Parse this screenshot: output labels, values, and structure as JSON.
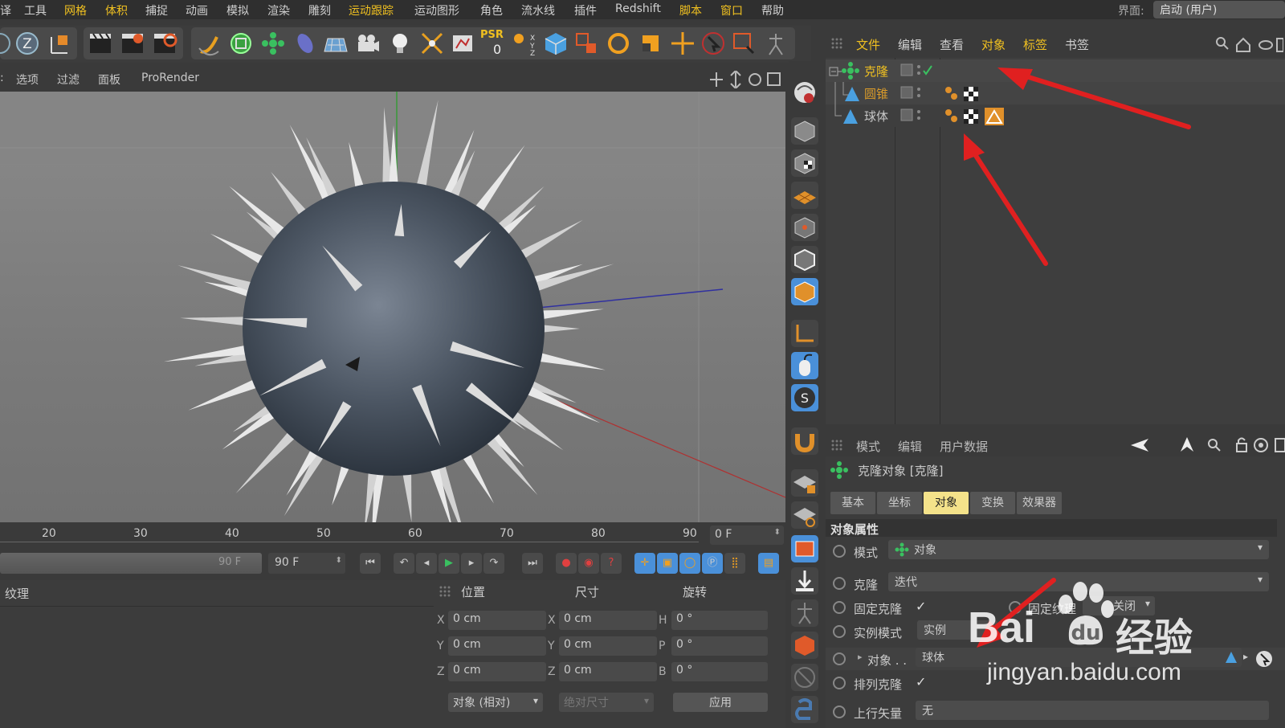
{
  "menubar": {
    "items": [
      "译",
      "工具",
      "网格",
      "体积",
      "捕捉",
      "动画",
      "模拟",
      "渲染",
      "雕刻",
      "运动跟踪",
      "运动图形",
      "角色",
      "流水线",
      "插件",
      "Redshift",
      "脚本",
      "窗口",
      "帮助"
    ],
    "interface_label": "界面:",
    "interface_value": "启动 (用户)"
  },
  "toolbar": {
    "psr_label": "PSR",
    "psr_value": "0"
  },
  "viewport": {
    "menu": [
      "选项",
      "过滤",
      "面板",
      "ProRender"
    ]
  },
  "object_manager": {
    "menu": [
      "文件",
      "编辑",
      "查看",
      "对象",
      "标签",
      "书签"
    ],
    "objects": [
      {
        "name": "克隆",
        "color": "#f0c020"
      },
      {
        "name": "圆锥",
        "color": "#d89a2a"
      },
      {
        "name": "球体",
        "color": "#c8c8c8"
      }
    ]
  },
  "attribute_manager": {
    "menu": [
      "模式",
      "编辑",
      "用户数据"
    ],
    "title": "克隆对象 [克隆]",
    "tabs": [
      "基本",
      "坐标",
      "对象",
      "变换",
      "效果器"
    ],
    "active_tab": "对象",
    "section": "对象属性",
    "props": {
      "mode_label": "模式",
      "mode_value": "对象",
      "clone_label": "克隆",
      "clone_value": "迭代",
      "fixed_clone_label": "固定克隆",
      "fixed_tex_label": "固定纹理",
      "fixed_tex_value": "关闭",
      "instance_label": "实例模式",
      "instance_value": "实例",
      "object_label": "对象 . .",
      "object_value": "球体",
      "arrange_label": "排列克隆",
      "up_vector_label": "上行矢量",
      "up_vector_value": "无"
    }
  },
  "timeline": {
    "ticks": [
      "20",
      "30",
      "40",
      "50",
      "60",
      "70",
      "80",
      "90"
    ],
    "current_frame": "0 F",
    "end_frame_slider": "90 F",
    "end_frame_field": "90 F"
  },
  "materials": {
    "title": "纹理"
  },
  "coordinates": {
    "headers": [
      "位置",
      "尺寸",
      "旋转"
    ],
    "position": [
      {
        "axis": "X",
        "value": "0 cm"
      },
      {
        "axis": "Y",
        "value": "0 cm"
      },
      {
        "axis": "Z",
        "value": "0 cm"
      }
    ],
    "size": [
      {
        "axis": "X",
        "value": "0 cm"
      },
      {
        "axis": "Y",
        "value": "0 cm"
      },
      {
        "axis": "Z",
        "value": "0 cm"
      }
    ],
    "rotation": [
      {
        "axis": "H",
        "value": "0 °"
      },
      {
        "axis": "P",
        "value": "0 °"
      },
      {
        "axis": "B",
        "value": "0 °"
      }
    ],
    "mode_select": "对象 (相对)",
    "size_select": "绝对尺寸",
    "apply": "应用"
  },
  "watermark": {
    "brand": "Bai",
    "brand2": "经验",
    "url": "jingyan.baidu.com"
  },
  "colors": {
    "accent": "#f0c020",
    "active_tab": "#f4e28a",
    "arrow": "#e02020"
  }
}
